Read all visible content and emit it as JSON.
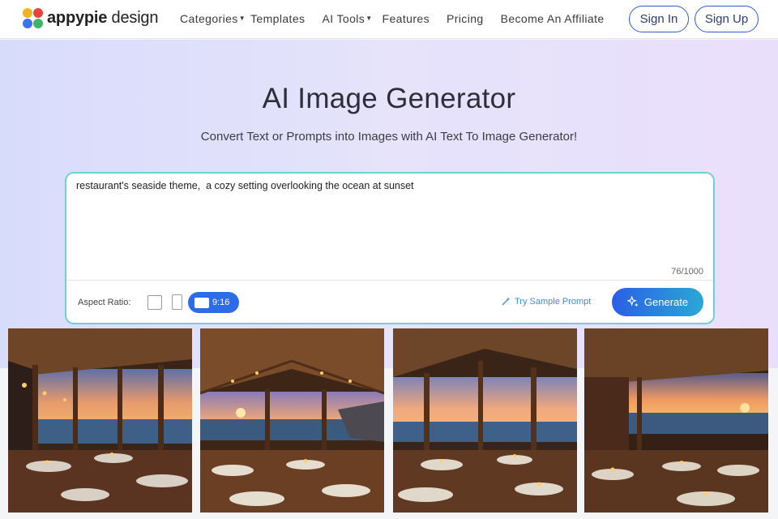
{
  "nav": {
    "logo_bold": "appypie",
    "logo_light": "design",
    "items": [
      {
        "label": "Categories",
        "caret": true
      },
      {
        "label": "Templates",
        "caret": false
      },
      {
        "label": "AI Tools",
        "caret": true
      },
      {
        "label": "Features",
        "caret": false
      },
      {
        "label": "Pricing",
        "caret": false
      },
      {
        "label": "Become An Affiliate",
        "caret": false
      }
    ],
    "sign_in": "Sign In",
    "sign_up": "Sign Up"
  },
  "hero": {
    "title": "AI Image Generator",
    "subtitle": "Convert Text or Prompts into Images with AI Text To Image Generator!"
  },
  "prompt": {
    "value": "restaurant's seaside theme,  a cozy setting overlooking the ocean at sunset",
    "counter": "76/1000",
    "aspect_label": "Aspect Ratio:",
    "ratio_selected": "9:16",
    "sample_label": "Try Sample Prompt",
    "generate_label": "Generate"
  },
  "gallery": {
    "images": [
      {
        "name": "seaside-restaurant-image-1"
      },
      {
        "name": "seaside-restaurant-image-2"
      },
      {
        "name": "seaside-restaurant-image-3"
      },
      {
        "name": "seaside-restaurant-image-4"
      }
    ]
  },
  "colors": {
    "brand_blue": "#2b5bd7",
    "accent_teal": "#6fd0d6",
    "generate_start": "#2a5fe4",
    "generate_end": "#2aa8d6"
  },
  "icons": [
    "logo-mark-icon",
    "caret-down-icon",
    "magic-wand-icon",
    "sparkle-icon"
  ]
}
